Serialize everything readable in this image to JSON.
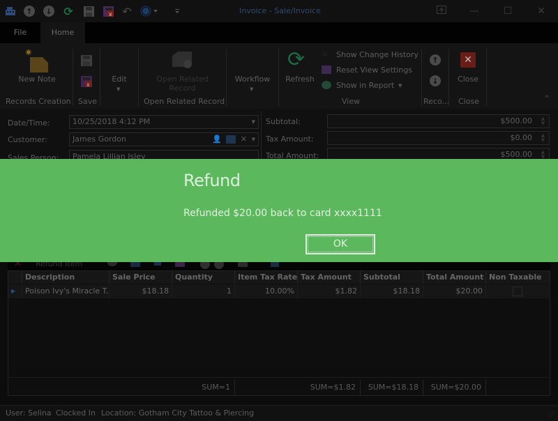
{
  "window": {
    "title": "Invoice  - Sale/Invoice",
    "quick_access": [
      "cash-register-icon",
      "arrow-up-icon",
      "arrow-down-icon",
      "refresh-icon",
      "save-icon",
      "save-close-icon",
      "undo-icon",
      "circle-dropdown-icon",
      "customize-icon"
    ]
  },
  "tabs": [
    {
      "label": "File",
      "active": false
    },
    {
      "label": "Home",
      "active": true
    }
  ],
  "ribbon": {
    "new_note": "New Note",
    "edit": "Edit",
    "open_related_record": "Open Related Record",
    "workflow": "Workflow",
    "refresh": "Refresh",
    "show_change_history": "Show Change History",
    "reset_view_settings": "Reset View Settings",
    "show_in_report": "Show in Report",
    "close": "Close",
    "groups": {
      "records_creation": "Records Creation",
      "save": "Save",
      "open_related_record": "Open Related Record",
      "view": "View",
      "reco": "Reco...",
      "close": "Close"
    }
  },
  "form": {
    "datetime_label": "Date/Time:",
    "datetime_value": "10/25/2018 4:12 PM",
    "customer_label": "Customer:",
    "customer_value": "James Gordon",
    "sales_person_label": "Sales Person:",
    "sales_person_value": "Pamela Lillian Isley",
    "subtotal_label": "Subtotal:",
    "subtotal_value": "$500.00",
    "tax_amount_label": "Tax Amount:",
    "tax_amount_value": "$0.00",
    "total_amount_label": "Total Amount:",
    "total_amount_value": "$500.00"
  },
  "dialog": {
    "title": "Refund",
    "message": "Refunded $20.00 back to card xxxx1111",
    "ok_label": "OK",
    "background": "#5cb85c"
  },
  "grid_toolbar": {
    "refund_item": "Refund Item"
  },
  "grid": {
    "columns": [
      "Description",
      "Sale Price",
      "Quantity",
      "Item Tax Rate",
      "Tax Amount",
      "Subtotal",
      "Total Amount",
      "Non Taxable"
    ],
    "rows": [
      {
        "description": "Poison Ivy's Miracle T...",
        "sale_price": "$18.18",
        "quantity": "1",
        "item_tax_rate": "10.00%",
        "tax_amount": "$1.82",
        "subtotal": "$18.18",
        "total_amount": "$20.00",
        "non_taxable": false
      }
    ],
    "sums": {
      "quantity": "SUM=1",
      "tax_amount": "SUM=$1.82",
      "subtotal": "SUM=$18.18",
      "total_amount": "SUM=$20.00"
    }
  },
  "status": {
    "user": "User: Selina",
    "clocked": "Clocked In",
    "location": "Location: Gotham City Tattoo & Piercing"
  }
}
